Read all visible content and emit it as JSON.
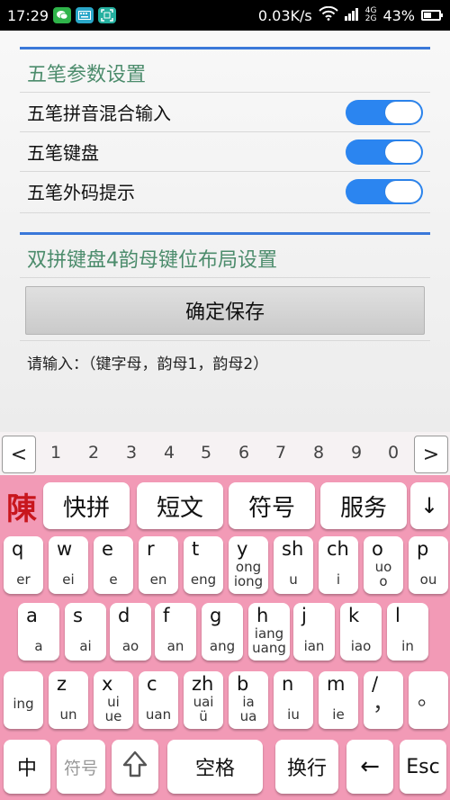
{
  "status": {
    "time": "17:29",
    "speed": "0.03K/s",
    "net_4g": "4G",
    "net_2g": "2G",
    "battery": "43%",
    "battery_level": 0.43
  },
  "wubi": {
    "title": "五笔参数设置",
    "rows": [
      {
        "label": "五笔拼音混合输入",
        "on": true
      },
      {
        "label": "五笔键盘",
        "on": true
      },
      {
        "label": "五笔外码提示",
        "on": true
      }
    ]
  },
  "shuangpin": {
    "title": "双拼键盘4韵母键位布局设置",
    "save_label": "确定保存",
    "hint": "请输入：（键字母，韵母1，韵母2）"
  },
  "keyboard": {
    "prev": "<",
    "next": ">",
    "candidates": [
      "1",
      "2",
      "3",
      "4",
      "5",
      "6",
      "7",
      "8",
      "9",
      "0"
    ],
    "logo": "陳",
    "functions": [
      "快拼",
      "短文",
      "符号",
      "服务"
    ],
    "collapse": "↓",
    "row1": [
      {
        "main": "q",
        "sub": [
          "er"
        ]
      },
      {
        "main": "w",
        "sub": [
          "ei"
        ]
      },
      {
        "main": "e",
        "sub": [
          "e"
        ]
      },
      {
        "main": "r",
        "sub": [
          "en"
        ]
      },
      {
        "main": "t",
        "sub": [
          "eng"
        ]
      },
      {
        "main": "y",
        "sub": [
          "ong",
          "iong"
        ]
      },
      {
        "main": "sh",
        "sub": [
          "u"
        ]
      },
      {
        "main": "ch",
        "sub": [
          "i"
        ]
      },
      {
        "main": "o",
        "sub": [
          "uo",
          "o"
        ]
      },
      {
        "main": "p",
        "sub": [
          "ou"
        ]
      }
    ],
    "row2": [
      {
        "main": "a",
        "sub": [
          "a"
        ]
      },
      {
        "main": "s",
        "sub": [
          "ai"
        ]
      },
      {
        "main": "d",
        "sub": [
          "ao"
        ]
      },
      {
        "main": "f",
        "sub": [
          "an"
        ]
      },
      {
        "main": "g",
        "sub": [
          "ang"
        ]
      },
      {
        "main": "h",
        "sub": [
          "iang",
          "uang"
        ]
      },
      {
        "main": "j",
        "sub": [
          "ian"
        ]
      },
      {
        "main": "k",
        "sub": [
          "iao"
        ]
      },
      {
        "main": "l",
        "sub": [
          "in"
        ]
      }
    ],
    "row3": [
      {
        "main": "",
        "sub": [
          "ing"
        ]
      },
      {
        "main": "z",
        "sub": [
          "un"
        ]
      },
      {
        "main": "x",
        "sub": [
          "ui",
          "ue"
        ]
      },
      {
        "main": "c",
        "sub": [
          "uan"
        ]
      },
      {
        "main": "zh",
        "sub": [
          "uai",
          "ü"
        ]
      },
      {
        "main": "b",
        "sub": [
          "ia",
          "ua"
        ]
      },
      {
        "main": "n",
        "sub": [
          "iu"
        ]
      },
      {
        "main": "m",
        "sub": [
          "ie"
        ]
      },
      {
        "main": "/",
        "sub": [
          "，"
        ]
      },
      {
        "main": "",
        "sub": [
          "。"
        ]
      }
    ],
    "bottom": {
      "zh": "中",
      "symbol": "符号",
      "space": "空格",
      "enter": "换行",
      "backspace": "←",
      "esc": "Esc"
    }
  },
  "colors": {
    "accent": "#3a78d9",
    "toggle": "#2b85f0",
    "section_title": "#4c8c6c",
    "keyboard_bg": "#f29ab6"
  }
}
